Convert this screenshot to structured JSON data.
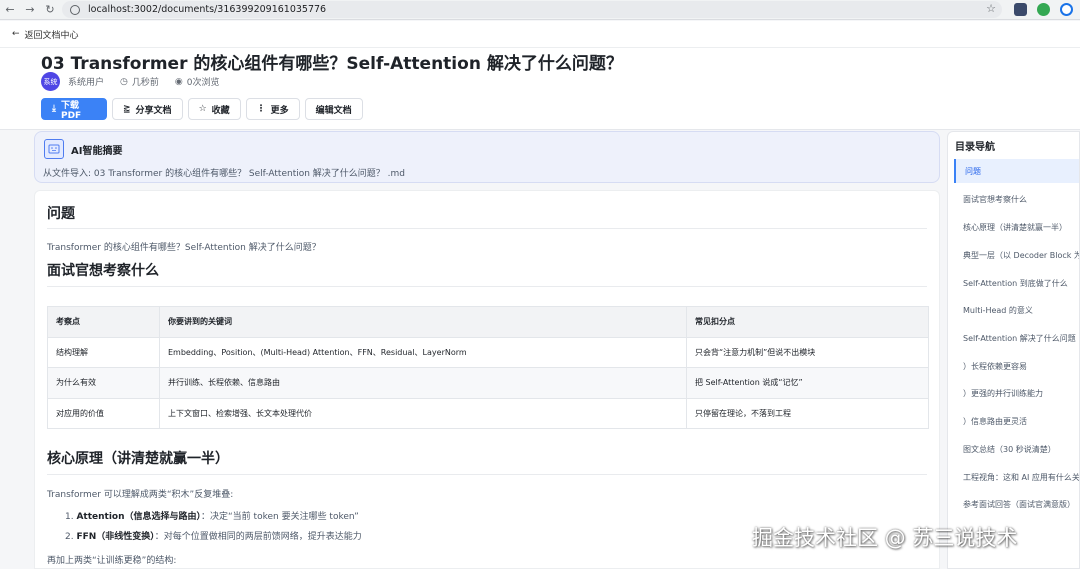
{
  "browser": {
    "url": "localhost:3002/documents/316399209161035776"
  },
  "topbar": {
    "back_label": "返回文档中心"
  },
  "document": {
    "title": "03 Transformer 的核心组件有哪些？Self-Attention 解决了什么问题？",
    "author_avatar": "系统",
    "author": "系统用户",
    "time": "几秒前",
    "views": "0次浏览"
  },
  "actions": {
    "download": "下载PDF",
    "share": "分享文档",
    "favorite": "收藏",
    "more": "更多",
    "edit": "编辑文档"
  },
  "ai_summary": {
    "title": "AI智能摘要",
    "text": "从文件导入: 03 Transformer 的核心组件有哪些？ Self-Attention 解决了什么问题？ .md"
  },
  "content": {
    "h_problem": "问题",
    "p_problem": "Transformer 的核心组件有哪些？Self-Attention 解决了什么问题？",
    "h_interviewer": "面试官想考察什么",
    "table": {
      "headers": [
        "考察点",
        "你要讲到的关键词",
        "常见扣分点"
      ],
      "rows": [
        [
          "结构理解",
          "Embedding、Position、(Multi-Head) Attention、FFN、Residual、LayerNorm",
          "只会背“注意力机制”但说不出模块"
        ],
        [
          "为什么有效",
          "并行训练、长程依赖、信息路由",
          "把 Self-Attention 说成“记忆”"
        ],
        [
          "对应用的价值",
          "上下文窗口、检索增强、长文本处理代价",
          "只停留在理论，不落到工程"
        ]
      ]
    },
    "h_core": "核心原理（讲清楚就赢一半）",
    "p_core": "Transformer 可以理解成两类“积木”反复堆叠:",
    "list": [
      {
        "bold": "Attention（信息选择与路由）",
        "text": "：决定“当前 token 要关注哪些 token”"
      },
      {
        "bold": "FFN（非线性变换）",
        "text": "：对每个位置做相同的两层前馈网络，提升表达能力"
      }
    ],
    "p_more": "再加上两类“让训练更稳”的结构:"
  },
  "toc": {
    "title": "目录导航",
    "items": [
      "问题",
      "面试官想考察什么",
      "核心原理（讲清楚就赢一半）",
      "典型一层（以 Decoder Block 为",
      "Self-Attention 到底做了什么",
      "Multi-Head 的意义",
      "Self-Attention 解决了什么问题",
      "）长程依赖更容易",
      "）更强的并行训练能力",
      "）信息路由更灵活",
      "图文总结（30 秒说清楚）",
      "工程视角：这和 AI 应用有什么关",
      "参考面试回答（面试官满意版）"
    ]
  },
  "watermark": "掘金技术社区 @ 苏三说技术"
}
